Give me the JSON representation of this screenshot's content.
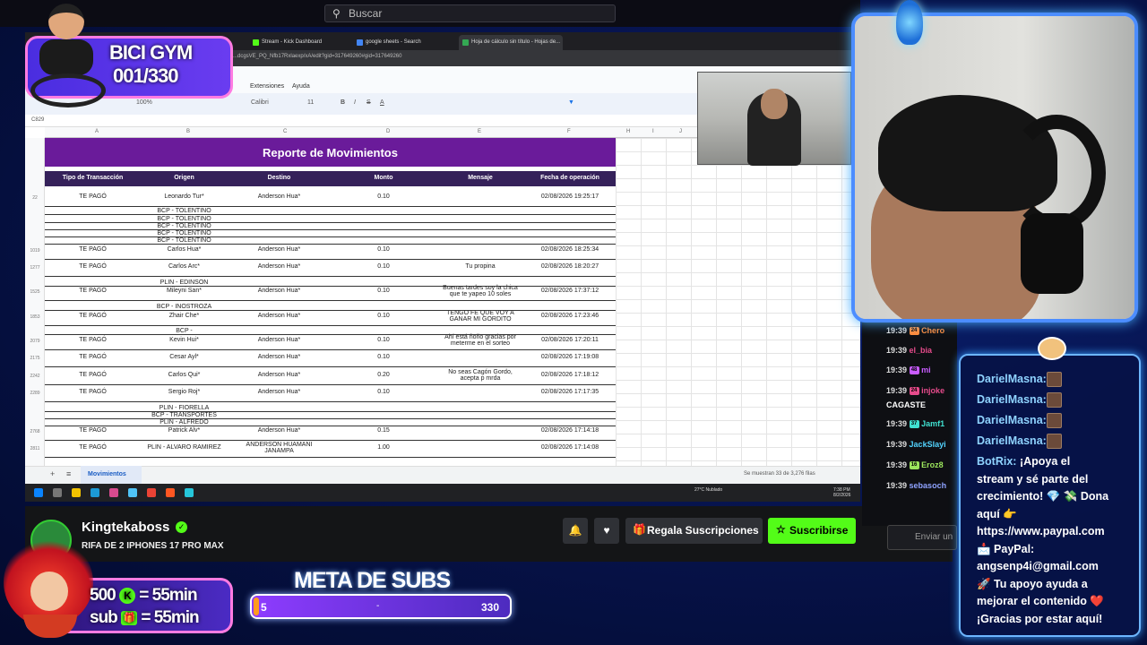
{
  "browser_search": {
    "placeholder": "Buscar"
  },
  "tabs": [
    {
      "label": "Stream - Kick Dashboard",
      "color": "#53fc18"
    },
    {
      "label": "google sheets - Search",
      "color": "#4285f4"
    },
    {
      "label": "Hoja de cálculo sin título - Hojas de...",
      "color": "#34a853"
    }
  ],
  "url": "...dcgsVE_PQ_Nfb17Rxlaexp/xA/edit?gid=317649260#gid=317649260",
  "sheet_menu": {
    "extensions": "Extensiones",
    "help": "Ayuda"
  },
  "toolbar": {
    "zoom": "100%",
    "font": "Calibri",
    "size": "11"
  },
  "cell_ref": "C829",
  "columns": [
    "A",
    "B",
    "C",
    "D",
    "E",
    "F",
    "H",
    "I",
    "J"
  ],
  "sheet": {
    "title": "Reporte de Movimientos",
    "headers": [
      "Tipo de Transacción",
      "Origen",
      "Destino",
      "Monto",
      "Mensaje",
      "Fecha de operación"
    ],
    "rows": [
      {
        "n": "22",
        "tipo": "TE PAGÓ",
        "origen": "Leonardo Tur*",
        "destino": "Anderson Hua*",
        "monto": "0.10",
        "mensaje": "",
        "fecha": "02/08/2026 19:25:17"
      },
      {
        "n": "1019",
        "tipo": "TE PAGÓ",
        "origen": "Carlos Hua*",
        "destino": "Anderson Hua*",
        "monto": "0.10",
        "mensaje": "",
        "fecha": "02/08/2026 18:25:34"
      },
      {
        "n": "1277",
        "tipo": "TE PAGÓ",
        "origen": "Carlos Arc*",
        "destino": "Anderson Hua*",
        "monto": "0.10",
        "mensaje": "Tu propina",
        "fecha": "02/08/2026 18:20:27"
      },
      {
        "n": "1525",
        "tipo": "TE PAGÓ",
        "origen": "Mileyni San*",
        "destino": "Anderson Hua*",
        "monto": "0.10",
        "mensaje": "Buenas tardes soy la chica que te yapeo 10 soles",
        "fecha": "02/08/2026 17:37:12"
      },
      {
        "n": "1853",
        "tipo": "TE PAGÓ",
        "origen": "Zhair Che*",
        "destino": "Anderson Hua*",
        "monto": "0.10",
        "mensaje": "TENGO FE QUE VOY A GANAR MI GORDITO",
        "fecha": "02/08/2026 17:23:46"
      },
      {
        "n": "2079",
        "tipo": "TE PAGÓ",
        "origen": "Kevin Hui*",
        "destino": "Anderson Hua*",
        "monto": "0.10",
        "mensaje": "Ahí está ñoño gracias por meterme en el sorteo",
        "fecha": "02/08/2026 17:20:11"
      },
      {
        "n": "2175",
        "tipo": "TE PAGÓ",
        "origen": "Cesar Ayl*",
        "destino": "Anderson Hua*",
        "monto": "0.10",
        "mensaje": "",
        "fecha": "02/08/2026 17:19:08"
      },
      {
        "n": "2242",
        "tipo": "TE PAGÓ",
        "origen": "Carlos Qui*",
        "destino": "Anderson Hua*",
        "monto": "0.20",
        "mensaje": "No seas Cagón Gordo, acepta p mrda",
        "fecha": "02/08/2026 17:18:12"
      },
      {
        "n": "2289",
        "tipo": "TE PAGÓ",
        "origen": "Sergio Roj*",
        "destino": "Anderson Hua*",
        "monto": "0.10",
        "mensaje": "",
        "fecha": "02/08/2026 17:17:35"
      },
      {
        "n": "2768",
        "tipo": "TE PAGÓ",
        "origen": "Patrick Alv*",
        "destino": "Anderson Hua*",
        "monto": "0.15",
        "mensaje": "",
        "fecha": "02/08/2026 17:14:18"
      },
      {
        "n": "2811",
        "tipo": "TE PAGÓ",
        "origen": "PLIN - ALVARO RAMIREZ",
        "destino": "ANDERSON HUAMANI JANAMPA",
        "monto": "1.00",
        "mensaje": "",
        "fecha": "02/08/2026 17:14:08"
      }
    ],
    "collapsed": [
      "BCP - TOLENTINO",
      "BCP - TOLENTINO",
      "BCP - TOLENTINO",
      "BCP - TOLENTINO",
      "BCP - TOLENTINO",
      "PLIN - EDINSON",
      "BCP - INOSTROZA",
      "BCP -",
      "PLIN - FIORELLA",
      "BCP - TRANSPORTES",
      "PLIN - ALFREDO"
    ],
    "tab_name": "Movimientos",
    "footnote": "Se muestran 33 de 3,276 filas"
  },
  "taskbar": {
    "weather": "27°C Nublado",
    "time": "7:38 PM",
    "date": "8/2/2026"
  },
  "stream": {
    "name": "Kingtekaboss",
    "title": "RIFA DE 2 IPHONES 17 PRO MAX",
    "gift_label": "Regala Suscripciones",
    "subscribe_label": "Suscribirse",
    "chat_placeholder": "Enviar un"
  },
  "chat_left": [
    {
      "time": "19:39",
      "badge": "24",
      "user": "Chero",
      "color": "#ff8c3a"
    },
    {
      "time": "19:39",
      "badge": "",
      "user": "el_bia",
      "color": "#e64b8b"
    },
    {
      "time": "19:39",
      "badge": "48",
      "user": "mi",
      "color": "#c85cff"
    },
    {
      "time": "19:39",
      "badge": "24",
      "user": "injoke",
      "color": "#e64b8b"
    },
    {
      "time": "",
      "badge": "",
      "user": "CAGASTE",
      "color": "#ffffff"
    },
    {
      "time": "19:39",
      "badge": "37",
      "user": "Jamf1",
      "color": "#40e0d0"
    },
    {
      "time": "19:39",
      "badge": "",
      "user": "JackSlayi",
      "color": "#53d4ff"
    },
    {
      "time": "19:39",
      "badge": "16",
      "user": "Eroz8",
      "color": "#9be45c"
    },
    {
      "time": "19:39",
      "badge": "",
      "user": "sebasoch",
      "color": "#8fa3ff"
    }
  ],
  "chat_panel": {
    "repeat_user": "DarielMasna:",
    "bot_user": "BotRix:",
    "lines": [
      "¡Apoya el",
      "stream y sé parte del",
      "crecimiento! 💎 💸 Dona",
      "aquí 👉",
      "https://www.paypal.com",
      "📩 PayPal:",
      "angsenp4i@gmail.com",
      "🚀 Tu apoyo ayuda a",
      "mejorar el contenido ❤️",
      "¡Gracias por estar aquí!"
    ]
  },
  "overlays": {
    "bici_title": "BICI GYM",
    "bici_count": "001/330",
    "meta_title": "META DE SUBS",
    "meta_start": "5",
    "meta_dash": "-",
    "meta_end": "330",
    "meta_progress": 0.015,
    "subs_line1_a": "500",
    "subs_line1_b": "= 55min",
    "subs_line2_a": "sub",
    "subs_line2_b": "= 55min"
  },
  "colors": {
    "kick_green": "#53fc18",
    "sheet_title_purple": "#6a1b9a",
    "panel_blue": "#6db6ff"
  }
}
